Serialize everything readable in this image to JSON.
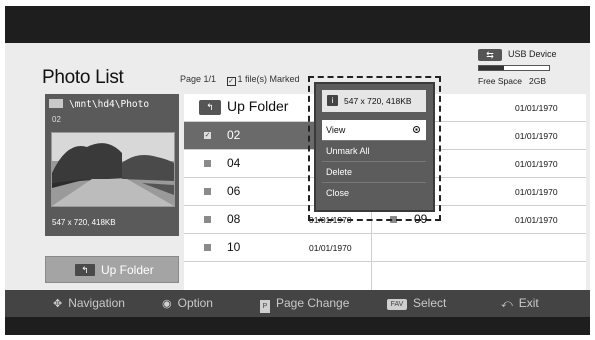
{
  "header": {
    "title": "Photo List",
    "page": "Page 1/1",
    "marked": "1 file(s) Marked"
  },
  "device": {
    "label": "USB Device",
    "free_space": "Free Space",
    "free_value": "2GB",
    "usage_fraction": 0.35
  },
  "preview": {
    "path": "\\mnt\\hd4\\Photo",
    "number": "02",
    "resolution": "547 x 720, 418KB"
  },
  "left_button": {
    "label": "Up Folder"
  },
  "files": {
    "up_folder": "Up Folder",
    "left": [
      {
        "name": "02",
        "date": "",
        "selected": true,
        "marked": true
      },
      {
        "name": "04",
        "date": "",
        "selected": false
      },
      {
        "name": "06",
        "date": "",
        "selected": false
      },
      {
        "name": "08",
        "date": "01/01/1970",
        "selected": false
      },
      {
        "name": "10",
        "date": "01/01/1970",
        "selected": false
      }
    ],
    "right": [
      {
        "name": "",
        "date": "01/01/1970"
      },
      {
        "name": "",
        "date": "01/01/1970"
      },
      {
        "name": "",
        "date": "01/01/1970"
      },
      {
        "name": "",
        "date": "01/01/1970"
      },
      {
        "name": "09",
        "date": "01/01/1970"
      }
    ]
  },
  "popup": {
    "info": "547 x 720, 418KB",
    "items": [
      "View",
      "Unmark All",
      "Delete",
      "Close"
    ],
    "active_index": 0
  },
  "bottom_bar": {
    "navigation": "Navigation",
    "option": "Option",
    "page_change": "Page Change",
    "fav": "FAV",
    "select": "Select",
    "exit": "Exit"
  },
  "icons": {
    "folder": "folder-icon",
    "info": "info-icon",
    "usb": "usb-icon"
  },
  "colors": {
    "screen_bg": "#1e1e1e",
    "panel_bg": "#ececec",
    "selected_row": "#6a6a6a",
    "popup_bg": "#5c5c5c"
  }
}
